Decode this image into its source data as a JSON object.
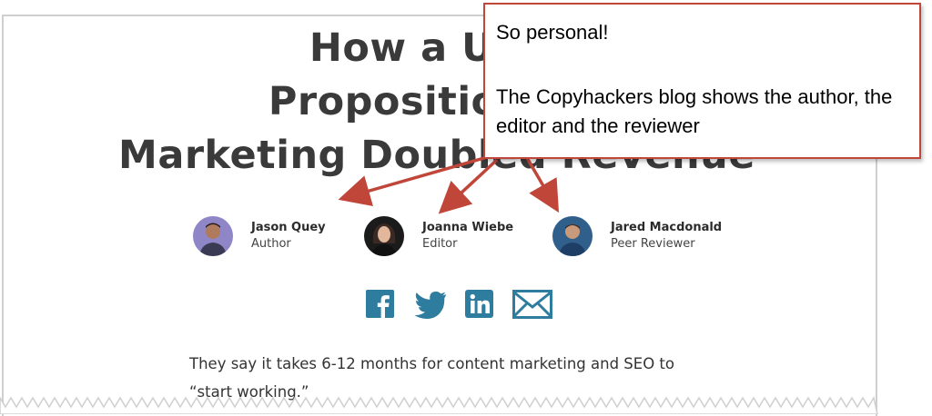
{
  "article": {
    "title": "How a Unique Selling Proposition for Content Marketing Doubled Revenue",
    "title_visible": "How a Uniq\nProposition for\nMarketing Doubled Revenue",
    "contributors": [
      {
        "name": "Jason Quey",
        "role": "Author"
      },
      {
        "name": "Joanna Wiebe",
        "role": "Editor"
      },
      {
        "name": "Jared Macdonald",
        "role": "Peer Reviewer"
      }
    ],
    "share_icons": [
      "facebook-icon",
      "twitter-icon",
      "linkedin-icon",
      "email-icon"
    ],
    "intro_line1": "They say it takes 6-12 months for content marketing and SEO to",
    "intro_line2": "“start working.”"
  },
  "callout": {
    "line1": "So personal!",
    "line2": "The Copyhackers blog shows the author, the editor and the reviewer"
  },
  "colors": {
    "share_icon": "#2e7c9e",
    "callout_border": "#c0463a",
    "title_text": "#3a3a3a"
  }
}
